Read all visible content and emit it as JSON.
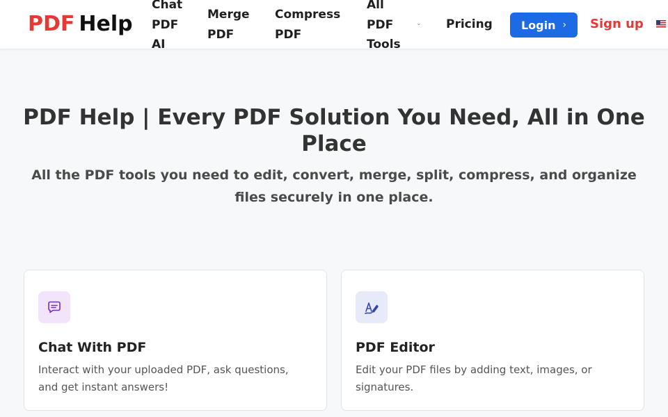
{
  "header": {
    "logo_pdf": "PDF",
    "logo_help": "Help",
    "nav": {
      "chat_pdf_ai": "Chat PDF AI",
      "merge_pdf": "Merge PDF",
      "compress_pdf": "Compress PDF",
      "all_pdf_tools": "All PDF Tools",
      "pricing": "Pricing"
    },
    "login_label": "Login",
    "signup_label": "Sign up",
    "language_icon": "us-flag-icon"
  },
  "hero": {
    "title": "PDF Help | Every PDF Solution You Need, All in One Place",
    "subtitle": "All the PDF tools you need to edit, convert, merge, split, compress, and organize files securely in one place."
  },
  "cards": [
    {
      "title": "Chat With PDF",
      "description": "Interact with your uploaded PDF, ask questions, and get instant answers!",
      "icon": "chat-bubble-icon",
      "icon_color": "#7b2cbf"
    },
    {
      "title": "PDF Editor",
      "description": "Edit your PDF files by adding text, images, or signatures.",
      "icon": "pen-edit-icon",
      "icon_color": "#3949ab"
    }
  ],
  "colors": {
    "brand_red": "#e53935",
    "login_blue": "#1d6ae5"
  }
}
